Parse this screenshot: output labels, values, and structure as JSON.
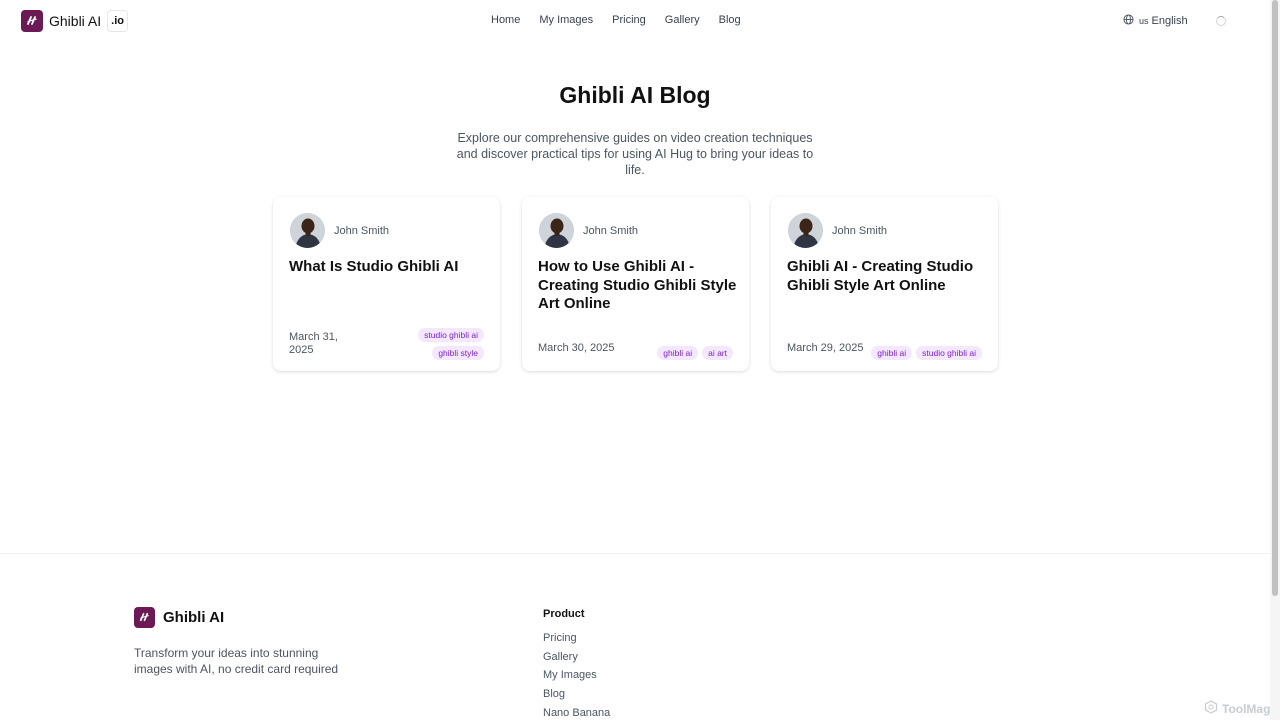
{
  "header": {
    "logo_text": "Ghibli AI",
    "logo_badge": ".io",
    "nav": [
      "Home",
      "My Images",
      "Pricing",
      "Gallery",
      "Blog"
    ],
    "lang_flag": "us",
    "lang_label": "English"
  },
  "hero": {
    "title": "Ghibli AI Blog",
    "subtitle": "Explore our comprehensive guides on video creation techniques and discover practical tips for using AI Hug to bring your ideas to life."
  },
  "posts": [
    {
      "author": "John Smith",
      "title": "What Is Studio Ghibli AI",
      "date": "March 31, 2025",
      "tags": [
        "studio ghibli ai",
        "ghibli style"
      ]
    },
    {
      "author": "John Smith",
      "title": "How to Use Ghibli AI - Creating Studio Ghibli Style Art Online",
      "date": "March 30, 2025",
      "tags": [
        "ghibli ai",
        "ai art"
      ]
    },
    {
      "author": "John Smith",
      "title": "Ghibli AI - Creating Studio Ghibli Style Art Online",
      "date": "March 29, 2025",
      "tags": [
        "ghibli ai",
        "studio ghibli ai"
      ]
    }
  ],
  "footer": {
    "brand": "Ghibli AI",
    "tagline": "Transform your ideas into stunning images with AI, no credit card required",
    "product_title": "Product",
    "product_links": [
      "Pricing",
      "Gallery",
      "My Images",
      "Blog",
      "Nano Banana"
    ]
  },
  "watermark": "ToolMage",
  "colors": {
    "brand": "#6b1a55",
    "tag_text": "#7e22ce",
    "tag_bg": "#f3e8ff"
  }
}
